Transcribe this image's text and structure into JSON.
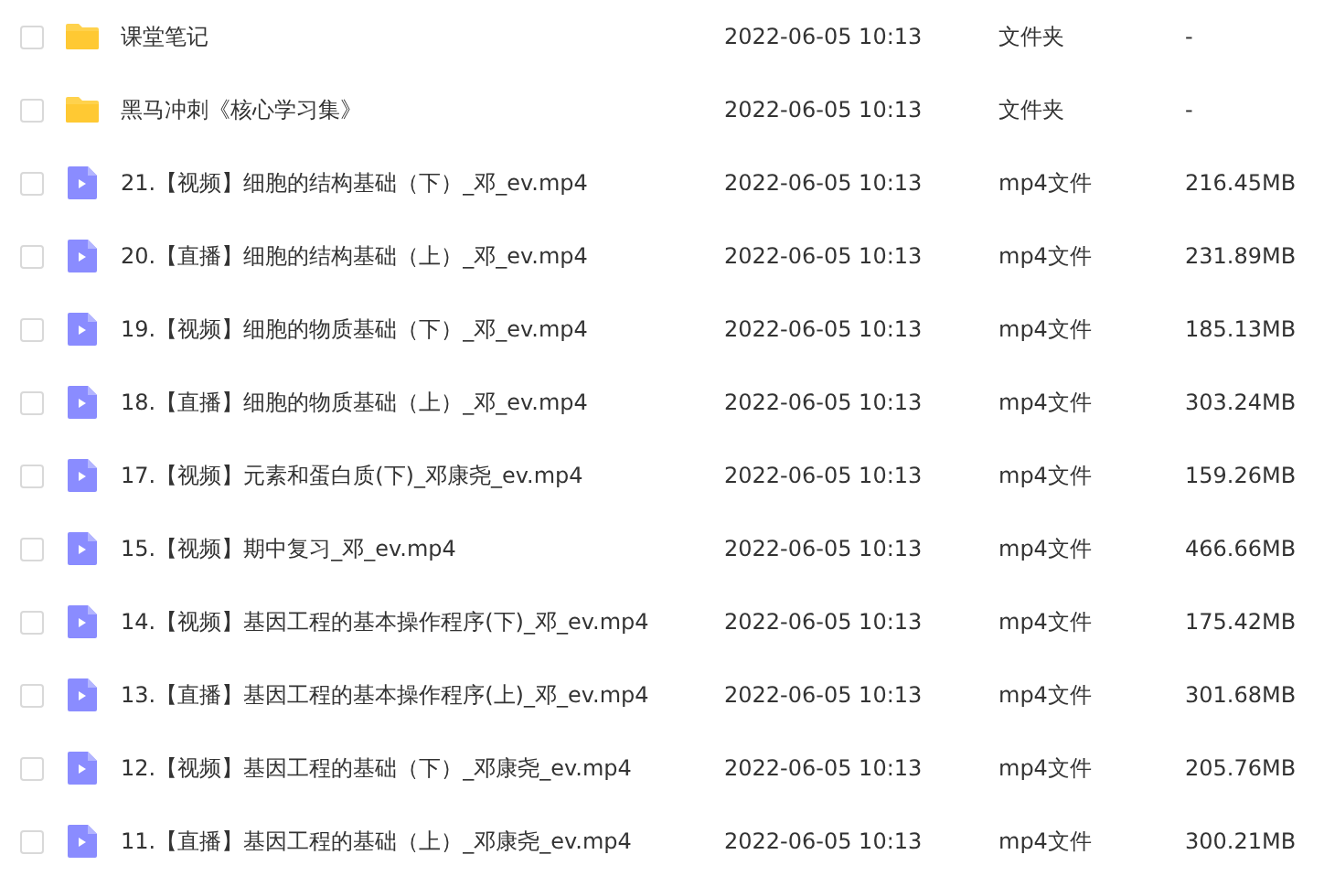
{
  "files": [
    {
      "kind": "folder",
      "checked": false,
      "name": "课堂笔记",
      "modified": "2022-06-05 10:13",
      "type": "文件夹",
      "size": "-"
    },
    {
      "kind": "folder",
      "checked": false,
      "name": "黑马冲刺《核心学习集》",
      "modified": "2022-06-05 10:13",
      "type": "文件夹",
      "size": "-"
    },
    {
      "kind": "video",
      "checked": false,
      "name": "21.【视频】细胞的结构基础（下）_邓_ev.mp4",
      "modified": "2022-06-05 10:13",
      "type": "mp4文件",
      "size": "216.45MB"
    },
    {
      "kind": "video",
      "checked": false,
      "name": "20.【直播】细胞的结构基础（上）_邓_ev.mp4",
      "modified": "2022-06-05 10:13",
      "type": "mp4文件",
      "size": "231.89MB"
    },
    {
      "kind": "video",
      "checked": false,
      "name": "19.【视频】细胞的物质基础（下）_邓_ev.mp4",
      "modified": "2022-06-05 10:13",
      "type": "mp4文件",
      "size": "185.13MB"
    },
    {
      "kind": "video",
      "checked": false,
      "name": "18.【直播】细胞的物质基础（上）_邓_ev.mp4",
      "modified": "2022-06-05 10:13",
      "type": "mp4文件",
      "size": "303.24MB"
    },
    {
      "kind": "video",
      "checked": false,
      "name": "17.【视频】元素和蛋白质(下)_邓康尧_ev.mp4",
      "modified": "2022-06-05 10:13",
      "type": "mp4文件",
      "size": "159.26MB"
    },
    {
      "kind": "video",
      "checked": false,
      "name": "15.【视频】期中复习_邓_ev.mp4",
      "modified": "2022-06-05 10:13",
      "type": "mp4文件",
      "size": "466.66MB"
    },
    {
      "kind": "video",
      "checked": false,
      "name": "14.【视频】基因工程的基本操作程序(下)_邓_ev.mp4",
      "modified": "2022-06-05 10:13",
      "type": "mp4文件",
      "size": "175.42MB"
    },
    {
      "kind": "video",
      "checked": false,
      "name": "13.【直播】基因工程的基本操作程序(上)_邓_ev.mp4",
      "modified": "2022-06-05 10:13",
      "type": "mp4文件",
      "size": "301.68MB"
    },
    {
      "kind": "video",
      "checked": false,
      "name": "12.【视频】基因工程的基础（下）_邓康尧_ev.mp4",
      "modified": "2022-06-05 10:13",
      "type": "mp4文件",
      "size": "205.76MB"
    },
    {
      "kind": "video",
      "checked": false,
      "name": "11.【直播】基因工程的基础（上）_邓康尧_ev.mp4",
      "modified": "2022-06-05 10:13",
      "type": "mp4文件",
      "size": "300.21MB"
    }
  ]
}
